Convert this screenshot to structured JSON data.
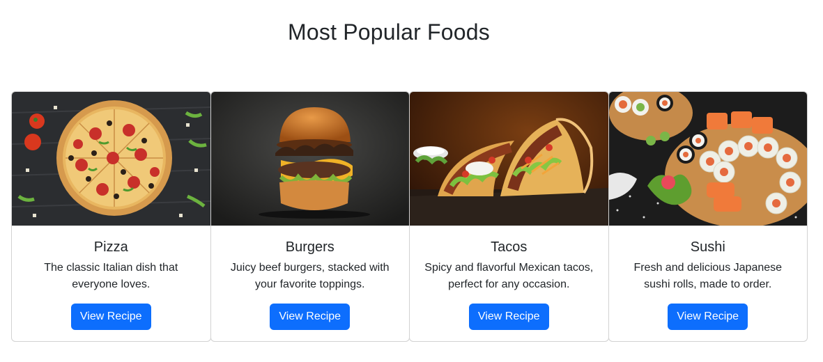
{
  "page": {
    "title": "Most Popular Foods"
  },
  "colors": {
    "button_bg": "#0d6efd",
    "button_text": "#ffffff",
    "title_text": "#212529"
  },
  "cards": [
    {
      "title": "Pizza",
      "text": "The classic Italian dish that everyone loves.",
      "button_label": "View Recipe",
      "image": "pizza-photo"
    },
    {
      "title": "Burgers",
      "text": "Juicy beef burgers, stacked with your favorite toppings.",
      "button_label": "View Recipe",
      "image": "burger-photo"
    },
    {
      "title": "Tacos",
      "text": "Spicy and flavorful Mexican tacos, perfect for any occasion.",
      "button_label": "View Recipe",
      "image": "tacos-photo"
    },
    {
      "title": "Sushi",
      "text": "Fresh and delicious Japanese sushi rolls, made to order.",
      "button_label": "View Recipe",
      "image": "sushi-photo"
    }
  ]
}
